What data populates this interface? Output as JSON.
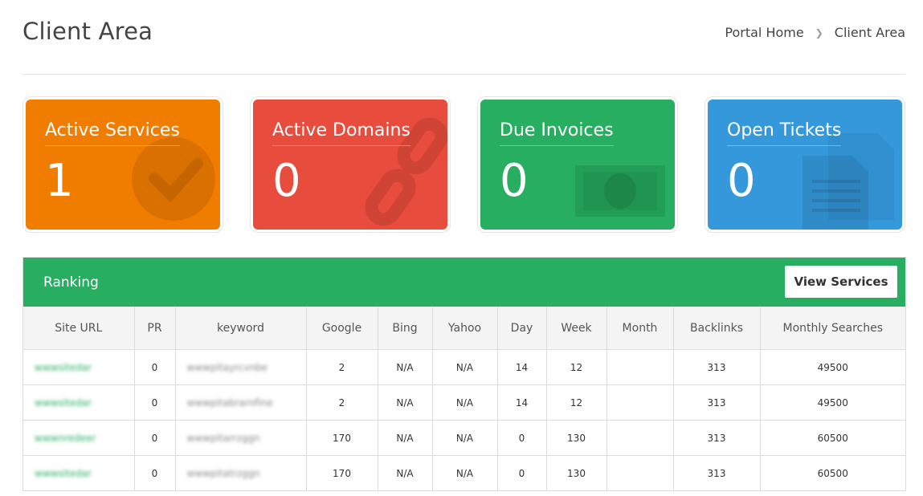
{
  "header": {
    "title": "Client Area",
    "breadcrumb": [
      "Portal Home",
      "Client Area"
    ]
  },
  "tiles": [
    {
      "label": "Active Services",
      "count": "1",
      "color": "#f07c00",
      "icon": "check-circle-icon"
    },
    {
      "label": "Active Domains",
      "count": "0",
      "color": "#e74c3c",
      "icon": "link-icon"
    },
    {
      "label": "Due Invoices",
      "count": "0",
      "color": "#27ae60",
      "icon": "money-icon"
    },
    {
      "label": "Open Tickets",
      "count": "0",
      "color": "#3498db",
      "icon": "documents-icon"
    }
  ],
  "ranking": {
    "title": "Ranking",
    "button_label": "View Services",
    "columns": [
      "Site URL",
      "PR",
      "keyword",
      "Google",
      "Bing",
      "Yahoo",
      "Day",
      "Week",
      "Month",
      "Backlinks",
      "Monthly Searches"
    ],
    "rows": [
      [
        "wwwsitedar",
        "0",
        "wwwpitayrcvnbe",
        "2",
        "N/A",
        "N/A",
        "14",
        "12",
        "",
        "313",
        "49500"
      ],
      [
        "wwwsitedar",
        "0",
        "wwwpitabrarnfine",
        "2",
        "N/A",
        "N/A",
        "14",
        "12",
        "",
        "313",
        "49500"
      ],
      [
        "wwwnredeer",
        "0",
        "wwwpitarrzggn",
        "170",
        "N/A",
        "N/A",
        "0",
        "130",
        "",
        "313",
        "60500"
      ],
      [
        "wwwsitedar",
        "0",
        "wwwpitatrzggn",
        "170",
        "N/A",
        "N/A",
        "0",
        "130",
        "",
        "313",
        "60500"
      ]
    ]
  }
}
